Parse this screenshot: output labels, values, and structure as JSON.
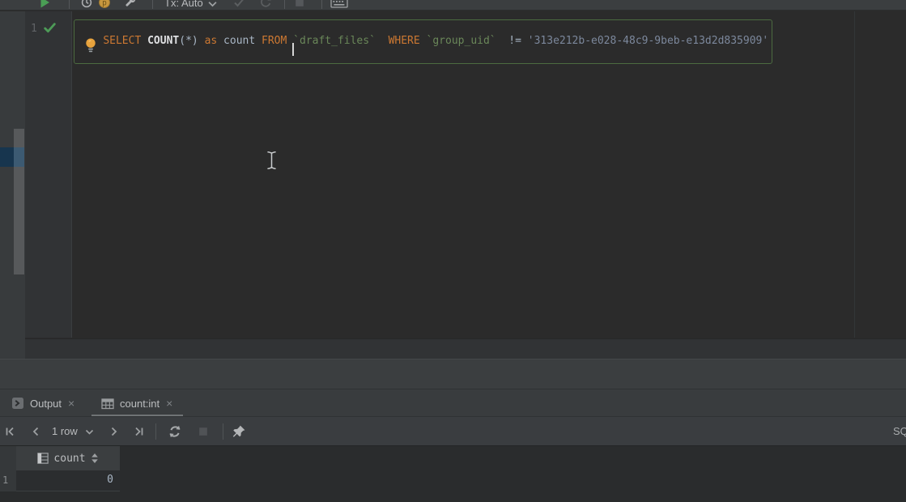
{
  "palette": {
    "editor_background": "#2b2b2b",
    "panel_background": "#3b3e40",
    "keyword_color": "#cc7832",
    "quoted_identifier_color": "#6a8759",
    "string_literal_color": "#7c889c",
    "statement_highlight_border": "#4c6b40",
    "success_check_green": "#4d9b57",
    "run_button_green": "#4a9e55",
    "bulb_orange": "#e8a33d",
    "selection_blue": "#17354e"
  },
  "top_toolbar": {
    "tx_mode_label": "Tx: Auto",
    "icons": [
      "run-icon",
      "history-clock-icon",
      "coin-icon",
      "wrench-icon",
      "commit-check-icon",
      "rollback-icon",
      "stop-icon",
      "keyboard-icon"
    ]
  },
  "editor": {
    "line_number": "1",
    "line_status": "executed-success",
    "caret_before_index": 10,
    "sql": [
      {
        "t": "SELECT ",
        "type": "keyword"
      },
      {
        "t": "COUNT",
        "type": "function"
      },
      {
        "t": "(",
        "type": "plain"
      },
      {
        "t": "*",
        "type": "plain"
      },
      {
        "t": ") ",
        "type": "plain"
      },
      {
        "t": "as",
        "type": "keyword"
      },
      {
        "t": " ",
        "type": "plain"
      },
      {
        "t": "count",
        "type": "plain"
      },
      {
        "t": " ",
        "type": "plain"
      },
      {
        "t": "FROM ",
        "type": "keyword"
      },
      {
        "t": "`draft_files`",
        "type": "identifier"
      },
      {
        "t": "  ",
        "type": "plain"
      },
      {
        "t": "WHERE",
        "type": "keyword"
      },
      {
        "t": " ",
        "type": "plain"
      },
      {
        "t": "`group_uid`",
        "type": "identifier"
      },
      {
        "t": "  ",
        "type": "plain"
      },
      {
        "t": "!=",
        "type": "operator"
      },
      {
        "t": " ",
        "type": "plain"
      },
      {
        "t": "'313e212b-e028-48c9-9beb-e13d2d835909'",
        "type": "string"
      }
    ]
  },
  "bottom_panel": {
    "ui": {
      "close_glyph": "×"
    },
    "tabs": [
      {
        "label": "Output",
        "icon": "terminal-icon",
        "active": false
      },
      {
        "label": "count:int",
        "icon": "table-icon",
        "active": true
      }
    ],
    "toolbar": {
      "pagination_label": "1 row",
      "datasource_label": "SQ",
      "icons": [
        "first-page-icon",
        "previous-page-icon",
        "next-page-icon",
        "last-page-icon",
        "refresh-icon",
        "stop-icon",
        "pin-icon"
      ]
    },
    "grid": {
      "column_header": "count",
      "rows": [
        {
          "n": "1",
          "count": "0"
        }
      ]
    }
  }
}
